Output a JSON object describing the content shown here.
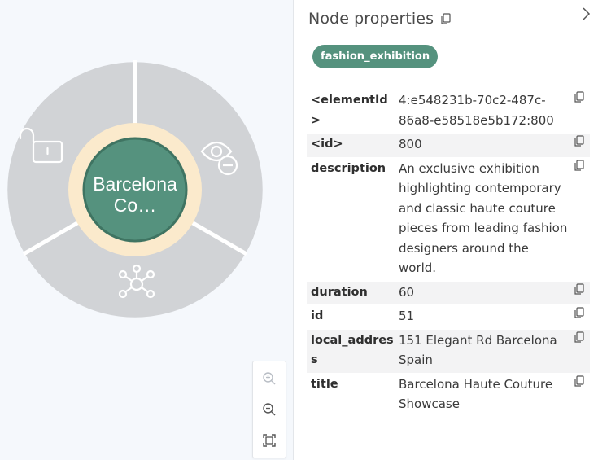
{
  "canvas": {
    "node": {
      "line1": "Barcelona",
      "line2": "Co…",
      "fill_color": "#55927e",
      "ring_color": "#fbeacc",
      "menu_color": "#d1d3d6"
    },
    "radial_menu": {
      "items": [
        {
          "icon": "unlock-icon",
          "action": "Unlock node"
        },
        {
          "icon": "hide-icon",
          "action": "Hide node"
        },
        {
          "icon": "expand-icon",
          "action": "Expand relationships"
        }
      ]
    },
    "zoom": {
      "zoom_in": "zoom-in-icon",
      "zoom_out": "zoom-out-icon",
      "fit": "fit-to-screen-icon"
    }
  },
  "panel": {
    "title": "Node properties",
    "label_badge": "fashion_exhibition",
    "properties": [
      {
        "key": "<elementId>",
        "value": "4:e548231b-70c2-487c-86a8-e58518e5b172:800"
      },
      {
        "key": "<id>",
        "value": "800"
      },
      {
        "key": "description",
        "value": "An exclusive exhibition highlighting contemporary and classic haute couture pieces from leading fashion designers around the world."
      },
      {
        "key": "duration",
        "value": "60"
      },
      {
        "key": "id",
        "value": "51"
      },
      {
        "key": "local_address",
        "value": "151 Elegant Rd Barcelona Spain"
      },
      {
        "key": "title",
        "value": "Barcelona Haute Couture Showcase"
      }
    ]
  },
  "colors": {
    "badge": "#55927e",
    "alt_row": "#f3f3f4"
  }
}
